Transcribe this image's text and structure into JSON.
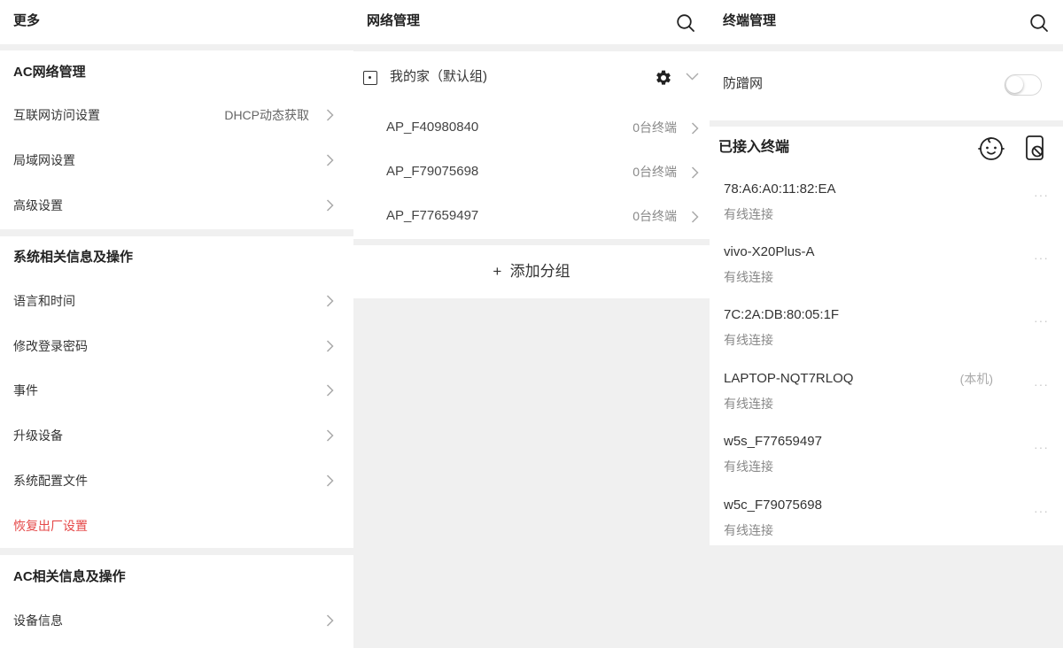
{
  "more_panel": {
    "title": "更多",
    "sections": [
      {
        "title": "AC网络管理",
        "items": [
          {
            "label": "互联网访问设置",
            "value": "DHCP动态获取"
          },
          {
            "label": "局域网设置"
          },
          {
            "label": "高级设置"
          }
        ]
      },
      {
        "title": "系统相关信息及操作",
        "items": [
          {
            "label": "语言和时间"
          },
          {
            "label": "修改登录密码"
          },
          {
            "label": "事件"
          },
          {
            "label": "升级设备"
          },
          {
            "label": "系统配置文件"
          },
          {
            "label": "恢复出厂设置"
          }
        ]
      },
      {
        "title": "AC相关信息及操作",
        "items": [
          {
            "label": "设备信息"
          }
        ]
      }
    ]
  },
  "network_panel": {
    "title": "网络管理",
    "search_icon": "search-icon",
    "group": {
      "name": "我的家（默认组)",
      "icons": [
        "checkbox-icon",
        "gear-icon",
        "chevron-down-icon"
      ],
      "aps": [
        {
          "name": "AP_F40980840",
          "count": "0台终端"
        },
        {
          "name": "AP_F79075698",
          "count": "0台终端"
        },
        {
          "name": "AP_F77659497",
          "count": "0台终端"
        }
      ]
    },
    "add_group": "+  添加分组"
  },
  "terminal_panel": {
    "title": "终端管理",
    "search_icon": "search-icon",
    "anti_freeload": {
      "label": "防蹭网",
      "enabled": false
    },
    "connected": {
      "title": "已接入终端",
      "icons": [
        "child-face-icon",
        "phone-lock-icon"
      ],
      "devices": [
        {
          "name": "78:A6:A0:11:82:EA",
          "type": "有线连接",
          "self": ""
        },
        {
          "name": "vivo-X20Plus-A",
          "type": "有线连接",
          "self": ""
        },
        {
          "name": "7C:2A:DB:80:05:1F",
          "type": "有线连接",
          "self": ""
        },
        {
          "name": "LAPTOP-NQT7RLOQ",
          "type": "有线连接",
          "self": "(本机)"
        },
        {
          "name": "w5s_F77659497",
          "type": "有线连接",
          "self": ""
        },
        {
          "name": "w5c_F79075698",
          "type": "有线连接",
          "self": ""
        }
      ],
      "more_symbol": "···"
    }
  },
  "colors": {
    "danger": "#e54848",
    "divider": "#f0f0f0",
    "muted": "#888888"
  }
}
